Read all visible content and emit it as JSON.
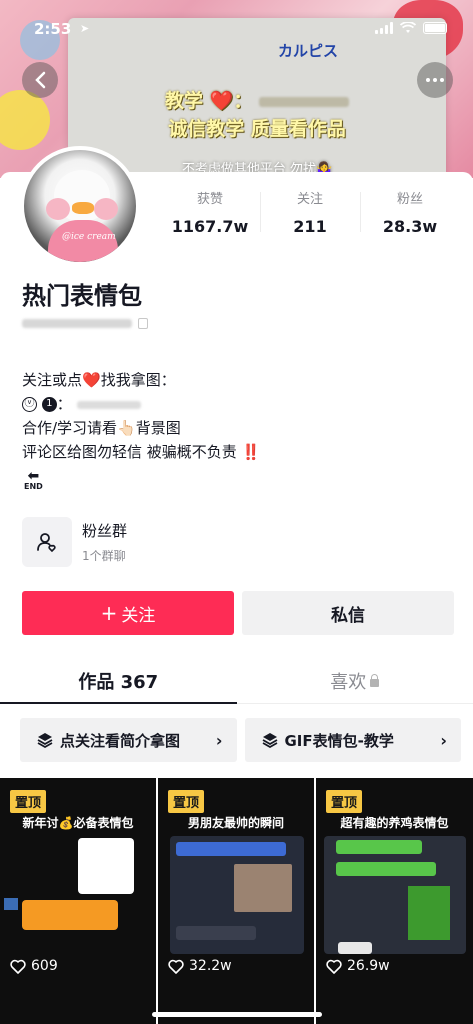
{
  "status_bar": {
    "time": "2:53",
    "location_icon": "location-arrow-icon"
  },
  "banner": {
    "brand": "カルピス",
    "line1": "教学 ❤️：",
    "line2": "诚信教学 质量看作品",
    "line3": "不考虑做其他平台 勿扰🤷‍♀️"
  },
  "avatar": {
    "tag": "@ice cream"
  },
  "stats": [
    {
      "label": "获赞",
      "value": "1167.7w"
    },
    {
      "label": "关注",
      "value": "211"
    },
    {
      "label": "粉丝",
      "value": "28.3w"
    }
  ],
  "profile": {
    "name": "热门表情包",
    "bio": {
      "line1_a": "关注或点",
      "line1_heart": "❤️",
      "line1_b": "找我拿图：",
      "line2_v": "ⓥ",
      "line2_1": "1",
      "line2_colon": "：",
      "line3": "合作/学习请看👆🏻背景图",
      "line4": "评论区给图勿轻信 被骗概不负责",
      "line4_bang": "‼️",
      "end_label": "END"
    }
  },
  "fans_group": {
    "title": "粉丝群",
    "subtitle": "1个群聊"
  },
  "actions": {
    "follow": "关注",
    "follow_plus": "+",
    "message": "私信"
  },
  "tabs": [
    {
      "label": "作品 367"
    },
    {
      "label": "喜欢"
    }
  ],
  "collections": [
    {
      "label": "点关注看简介拿图",
      "chevron": "›"
    },
    {
      "label": "GIF表情包-教学",
      "chevron": "›"
    }
  ],
  "videos": [
    {
      "pinned": "置顶",
      "title": "新年讨💰必备表情包",
      "likes": "609"
    },
    {
      "pinned": "置顶",
      "title": "男朋友最帅的瞬间",
      "likes": "32.2w"
    },
    {
      "pinned": "置顶",
      "title": "超有趣的养鸡表情包",
      "likes": "26.9w"
    }
  ],
  "colors": {
    "accent": "#fe2c55",
    "pinned": "#f7c744",
    "text": "#161823",
    "muted": "#8a8b91"
  }
}
